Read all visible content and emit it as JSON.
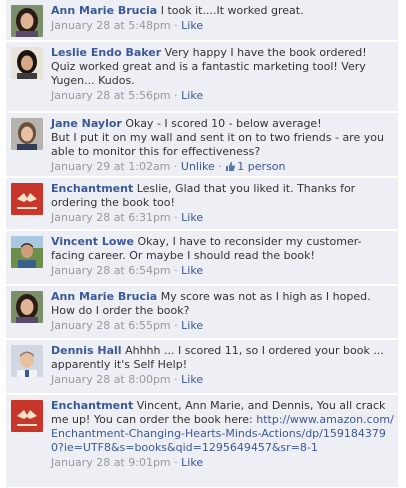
{
  "comments": [
    {
      "author": "Ann Marie Brucia",
      "text": "I took it....It worked great.",
      "timestamp": "January 28 at 5:48pm",
      "action": "Like",
      "avatar": "woman-dark-hair-avatar"
    },
    {
      "author": "Leslie Endo Baker",
      "text": "Very happy I have the book ordered! Quiz worked great and is a fantastic marketing tool! Very Yugen... Kudos.",
      "timestamp": "January 28 at 5:56pm",
      "action": "Like",
      "avatar": "woman-dark-hair-avatar"
    },
    {
      "author": "Jane Naylor",
      "text": "Okay - I scored 10 - below average!\nBut I put it on my wall and sent it on to two friends - are you able to monitor this for effectiveness?",
      "timestamp": "January 29 at 1:02am",
      "action": "Unlike",
      "like_count": "1 person",
      "avatar": "woman-avatar"
    },
    {
      "author": "Enchantment",
      "text": "Leslie, Glad that you liked it. Thanks for ordering the book too!",
      "timestamp": "January 28 at 6:31pm",
      "action": "Like",
      "avatar": "book-cover-avatar"
    },
    {
      "author": "Vincent Lowe",
      "text": "Okay, I have to reconsider my customer-facing career. Or maybe I should read the book!",
      "timestamp": "January 28 at 6:54pm",
      "action": "Like",
      "avatar": "man-outdoor-avatar"
    },
    {
      "author": "Ann Marie Brucia",
      "text": "My score was not as I high as I hoped. How do I order the book?",
      "timestamp": "January 28 at 6:55pm",
      "action": "Like",
      "avatar": "woman-dark-hair-avatar"
    },
    {
      "author": "Dennis Hall",
      "text": "Ahhhh ... I scored 11, so I ordered your book ... apparently it's Self Help!",
      "timestamp": "January 28 at 8:00pm",
      "action": "Like",
      "avatar": "man-avatar"
    },
    {
      "author": "Enchantment",
      "text": "Vincent, Ann Marie, and Dennis, You all crack me up! You can order the book here:",
      "url": "http://www.amazon.com/Enchantment-Changing-Hearts-Minds-Actions/dp/1591843790?ie=UTF8&s=books&qid=1295649457&sr=8-1",
      "timestamp": "January 28 at 9:01pm",
      "action": "Like",
      "avatar": "book-cover-avatar"
    }
  ],
  "separator": "·",
  "colors": {
    "comment_bg": "#edeff4",
    "link": "#3b5998",
    "meta": "#999999",
    "text": "#333333",
    "book_cover": "#c8362b"
  }
}
